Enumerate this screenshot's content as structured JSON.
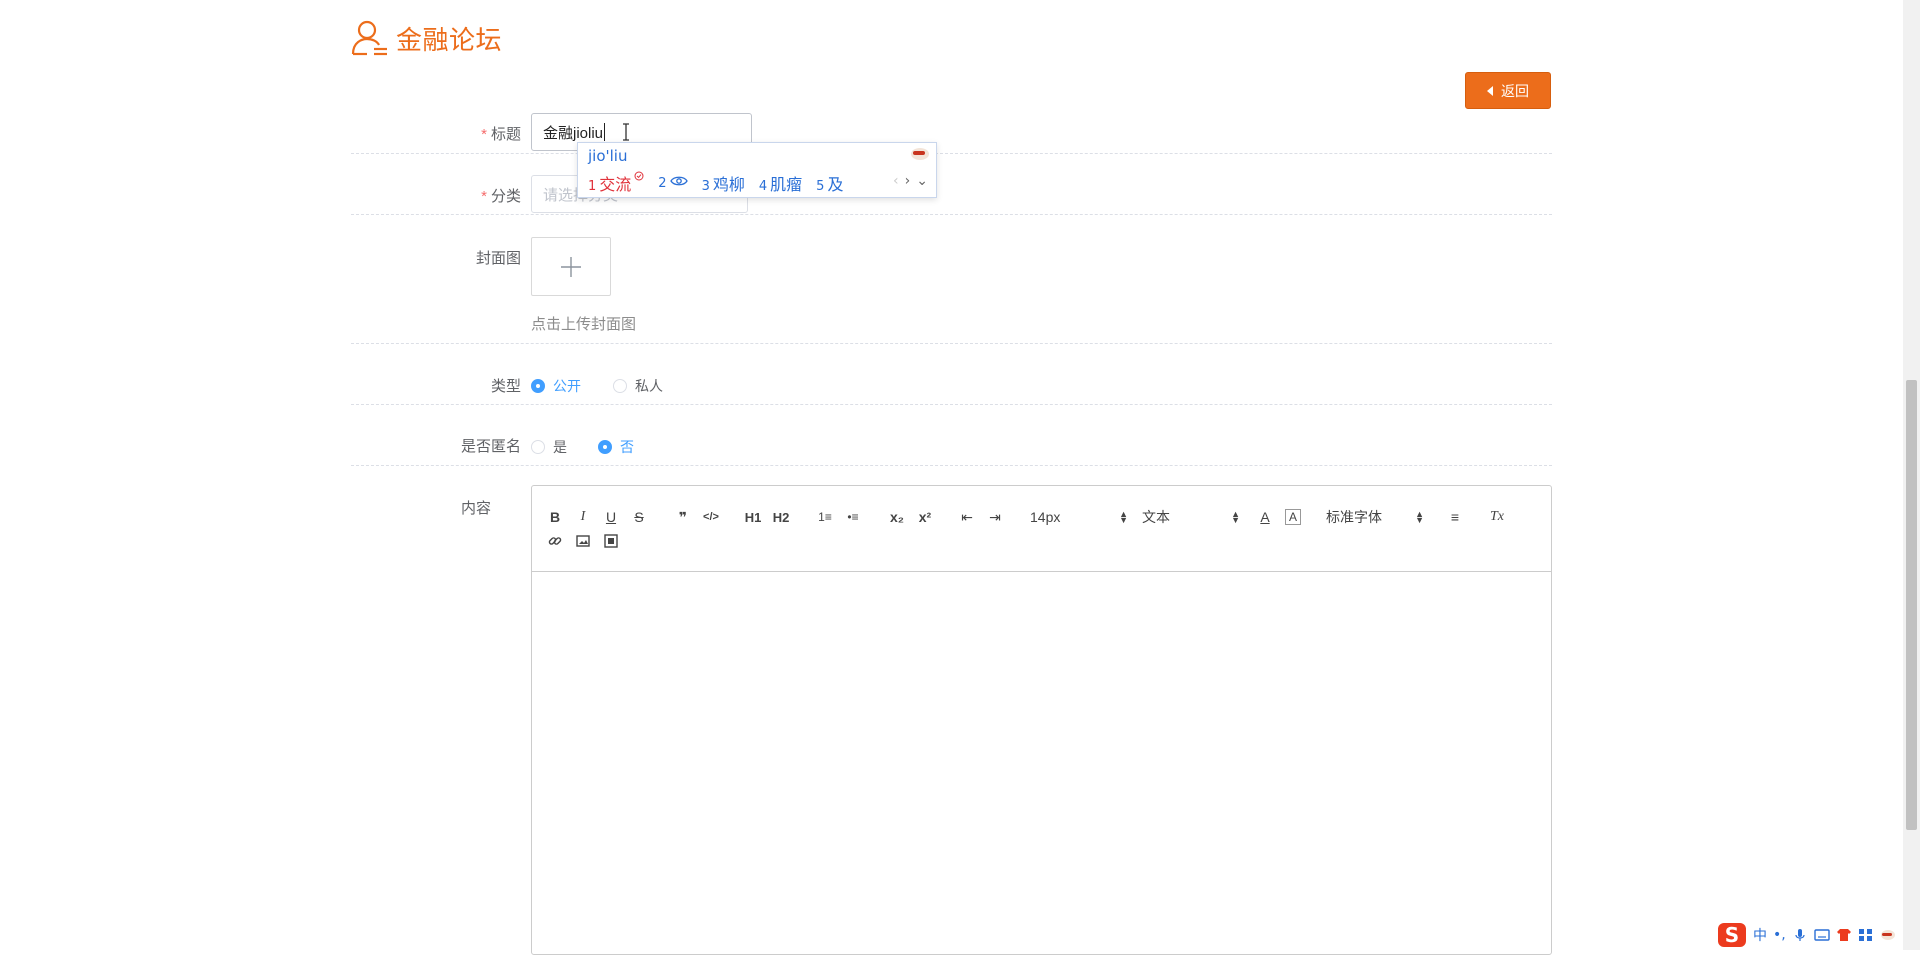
{
  "header": {
    "title": "金融论坛",
    "back_label": "返回"
  },
  "form": {
    "title_label": "标题",
    "title_value": "金融jioliu",
    "category_label": "分类",
    "category_placeholder": "请选择分类",
    "cover_label": "封面图",
    "cover_hint": "点击上传封面图",
    "type_label": "类型",
    "type_options": [
      "公开",
      "私人"
    ],
    "type_selected": "公开",
    "anon_label": "是否匿名",
    "anon_options": [
      "是",
      "否"
    ],
    "anon_selected": "否",
    "content_label": "内容"
  },
  "ime": {
    "pinyin": "jio'liu",
    "candidates": [
      {
        "num": "1",
        "text": "交流"
      },
      {
        "num": "2",
        "text": ""
      },
      {
        "num": "3",
        "text": "鸡柳"
      },
      {
        "num": "4",
        "text": "肌瘤"
      },
      {
        "num": "5",
        "text": "及"
      }
    ]
  },
  "editor": {
    "toolbar": {
      "bold": "B",
      "italic": "I",
      "underline": "U",
      "strike": "S",
      "blockquote": "❞",
      "code": "</>",
      "h1": "H1",
      "h2": "H2",
      "ordered_list": "1≡",
      "bullet_list": "•≡",
      "subscript": "x₂",
      "superscript": "x²",
      "indent_minus": "⇤",
      "indent_plus": "⇥",
      "size": "14px",
      "header": "文本",
      "font": "标准字体",
      "color": "A",
      "background": "A",
      "align": "≡",
      "clean": "Tx",
      "link": "🔗",
      "image": "▣",
      "video": "▦"
    }
  },
  "imebar": {
    "chinese_mode": "中",
    "punct": "•,"
  }
}
